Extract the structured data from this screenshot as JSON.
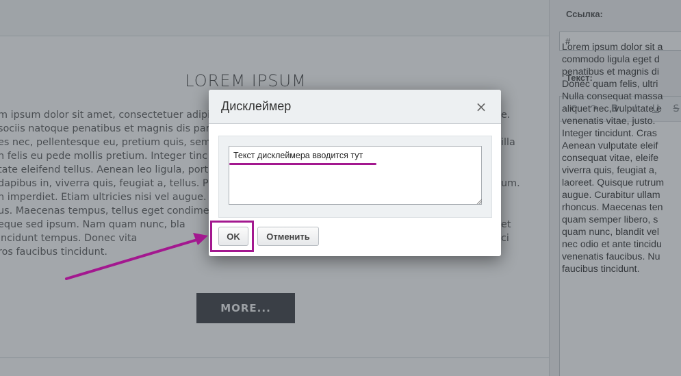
{
  "background": {
    "lorem_title": "LOREM IPSUM",
    "lorem_lines": [
      "m ipsum dolor sit amet, consectetuer adipi",
      "sociis natoque penatibus et magnis dis par",
      "es nec, pellentesque eu, pretium quis, sem.",
      "n felis eu pede mollis pretium. Integer tinc",
      "tate eleifend tellus. Aenean leo ligula, port",
      "dapibus in, viverra quis, feugiat a, tellus. P",
      "n imperdiet. Etiam ultricies nisi vel augue.",
      "us. Maecenas tempus, tellus eget condime",
      "eque sed ipsum. Nam quam nunc, bla",
      "incidunt tempus. Donec vita",
      "ros faucibus tincidunt."
    ],
    "lorem_right_lines": [
      "e.",
      "",
      "illa",
      "",
      "",
      "um.",
      "",
      "",
      "et",
      "ci"
    ],
    "more_button": "MORE..."
  },
  "right_panel": {
    "link_label": "Ссылка:",
    "link_value": "#",
    "text_label": "Текст:",
    "toolbar_icons": [
      "undo-icon",
      "redo-icon",
      "bold-icon",
      "italic-icon",
      "underline-icon",
      "strikethrough-icon"
    ],
    "toolbar_glyphs": [
      "↶",
      "↷",
      "B",
      "I",
      "U",
      "S"
    ],
    "editor_lines": [
      "Lorem ipsum dolor sit a",
      "commodo ligula eget d",
      "penatibus et magnis di",
      "Donec quam felis, ultri",
      "Nulla consequat massa",
      "aliquet nec, vulputate e",
      "venenatis vitae, justo.",
      "Integer tincidunt. Cras",
      "Aenean vulputate eleif",
      "consequat vitae, eleife",
      "viverra quis, feugiat a,",
      "laoreet. Quisque rutrum",
      "augue. Curabitur ullam",
      "rhoncus. Maecenas ten",
      "quam semper libero, s",
      "quam nunc, blandit vel",
      "nec odio et ante tincidu",
      "venenatis faucibus. Nu",
      "faucibus tincidunt."
    ]
  },
  "dialog": {
    "title": "Дисклеймер",
    "close_glyph": "×",
    "textarea_value": "Текст дисклеймера вводится тут",
    "ok_label": "OK",
    "cancel_label": "Отменить"
  },
  "colors": {
    "annotation": "#a3188f",
    "overlay": "rgba(35,45,55,0.42)"
  }
}
